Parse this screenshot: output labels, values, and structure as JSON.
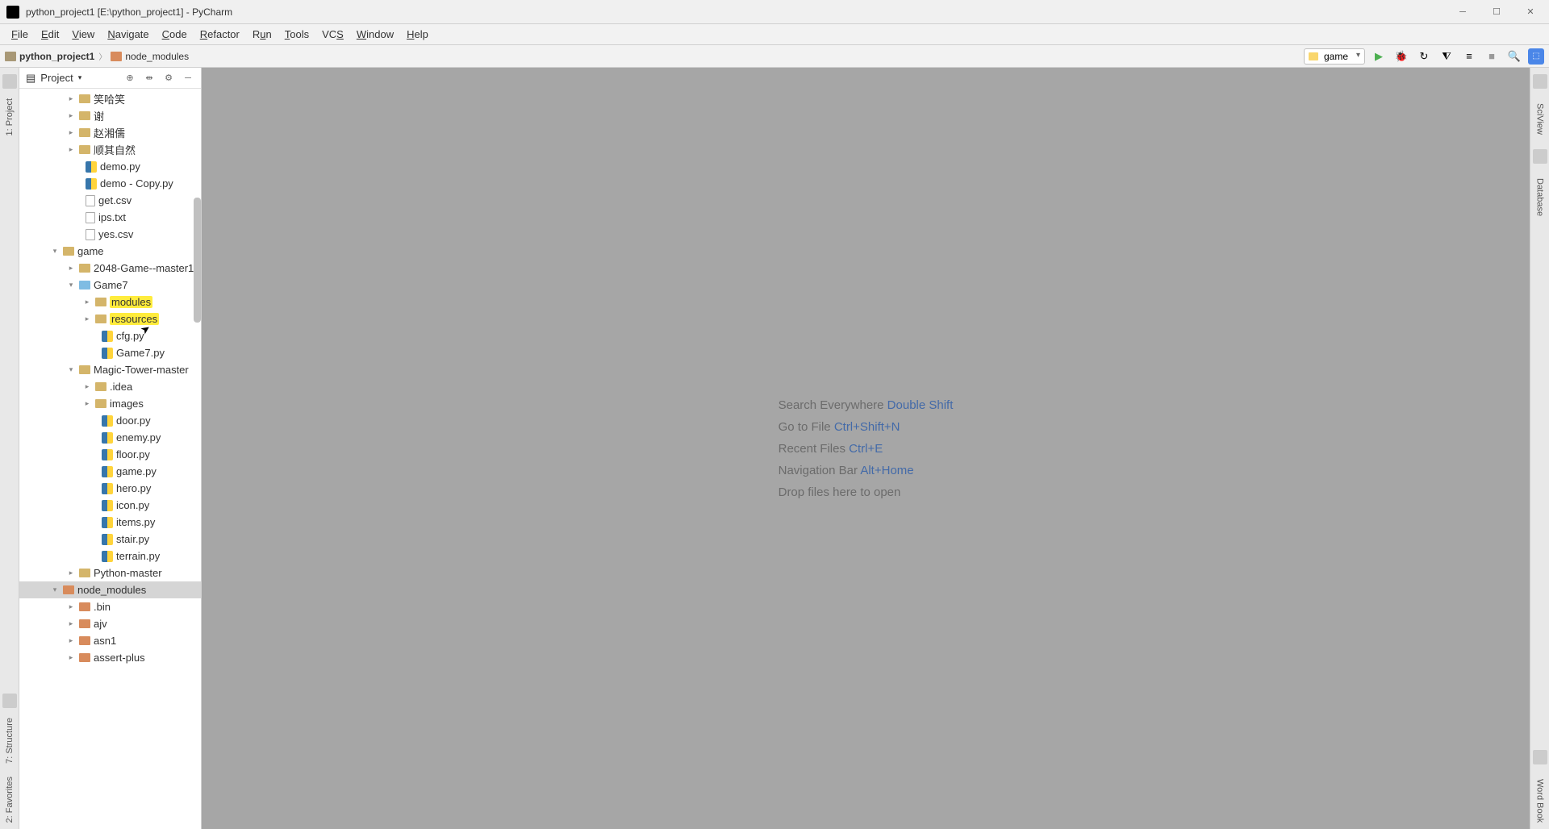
{
  "window": {
    "title": "python_project1 [E:\\python_project1] - PyCharm"
  },
  "menu": {
    "file": "File",
    "edit": "Edit",
    "view": "View",
    "navigate": "Navigate",
    "code": "Code",
    "refactor": "Refactor",
    "run": "Run",
    "tools": "Tools",
    "vcs": "VCS",
    "window": "Window",
    "help": "Help"
  },
  "breadcrumb": {
    "root": "python_project1",
    "node": "node_modules"
  },
  "toolbar": {
    "run_config": "game"
  },
  "panel": {
    "title": "Project"
  },
  "left_tabs": {
    "project": "1: Project",
    "structure": "7: Structure",
    "favorites": "2: Favorites"
  },
  "right_tabs": {
    "sciview": "SciView",
    "database": "Database",
    "wordbook": "Word Book"
  },
  "tree": {
    "f1": "笑哈笑",
    "f2": "谢",
    "f3": "赵湘儒",
    "f4": "顺其自然",
    "f5": "demo.py",
    "f6": "demo - Copy.py",
    "f7": "get.csv",
    "f8": "ips.txt",
    "f9": "yes.csv",
    "f10": "game",
    "f11": "2048-Game--master1",
    "f12": "Game7",
    "f13": "modules",
    "f14": "resources",
    "f15": "cfg.py",
    "f16": "Game7.py",
    "f17": "Magic-Tower-master",
    "f18": ".idea",
    "f19": "images",
    "f20": "door.py",
    "f21": "enemy.py",
    "f22": "floor.py",
    "f23": "game.py",
    "f24": "hero.py",
    "f25": "icon.py",
    "f26": "items.py",
    "f27": "stair.py",
    "f28": "terrain.py",
    "f29": "Python-master",
    "f30": "node_modules",
    "f31": ".bin",
    "f32": "ajv",
    "f33": "asn1",
    "f34": "assert-plus"
  },
  "hints": {
    "h1a": "Search Everywhere ",
    "h1b": "Double Shift",
    "h2a": "Go to File ",
    "h2b": "Ctrl+Shift+N",
    "h3a": "Recent Files ",
    "h3b": "Ctrl+E",
    "h4a": "Navigation Bar ",
    "h4b": "Alt+Home",
    "h5": "Drop files here to open"
  }
}
